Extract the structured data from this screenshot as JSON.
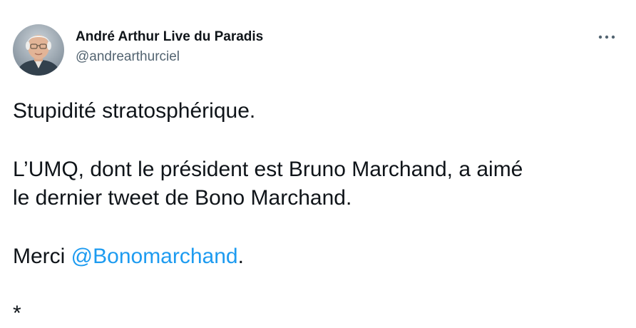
{
  "author": {
    "display_name": "André Arthur Live du Paradis",
    "handle": "@andrearthurciel",
    "avatar_icon": "profile-photo"
  },
  "menu": {
    "more_icon": "more-horizontal-icon"
  },
  "tweet": {
    "line1": "Stupidité stratosphérique.",
    "line2": "L’UMQ, dont le président est Bruno Marchand, a aimé",
    "line3": "le dernier tweet de Bono Marchand.",
    "line4_prefix": "Merci ",
    "mention": "@Bonomarchand",
    "line4_suffix": ".",
    "cut_off_glyph": "*"
  },
  "colors": {
    "text": "#0f1419",
    "secondary": "#536471",
    "link": "#1d9bf0"
  }
}
